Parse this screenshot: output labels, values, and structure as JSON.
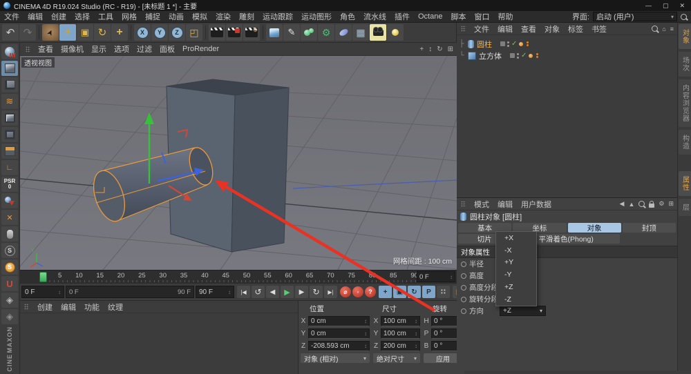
{
  "window": {
    "title": "CINEMA 4D R19.024 Studio (RC - R19) - [未标题 1 *] - 主要",
    "minimize": "—",
    "maximize": "▢",
    "close": "✕"
  },
  "menubar": {
    "items": [
      "文件",
      "编辑",
      "创建",
      "选择",
      "工具",
      "网格",
      "捕捉",
      "动画",
      "模拟",
      "渲染",
      "雕刻",
      "运动跟踪",
      "运动图形",
      "角色",
      "流水线",
      "插件",
      "Octane",
      "脚本",
      "窗口",
      "帮助"
    ],
    "interface_label": "界面:",
    "interface_value": "启动 (用户)"
  },
  "toolbar": {
    "undo": "↶",
    "redo": "↷",
    "select": "➤",
    "move": "+",
    "scale": "▣",
    "rotate": "↻",
    "last_tool": "+",
    "x": "X",
    "y": "Y",
    "z": "Z",
    "coord_system": "◰",
    "pen": "✎",
    "gear": "⚙",
    "floor": "▦"
  },
  "left_dock": {
    "psr_label": "PSR",
    "psr_value": "0",
    "axis": "∟",
    "workplane": "≋",
    "snap_x": "✕",
    "snap_s": "S",
    "snap_s_on": "S",
    "magnet": "U",
    "plane_a": "◈",
    "plane_b": "◈",
    "brand_line1": "MAXON",
    "brand_line2": "CINE"
  },
  "viewport": {
    "menu": [
      "查看",
      "摄像机",
      "显示",
      "选项",
      "过滤",
      "面板",
      "ProRender"
    ],
    "icons": {
      "pan": "+",
      "zoom": "↕",
      "rotate": "↻",
      "toggle": "⊞"
    },
    "view_label": "透视视图",
    "grid_info": "网格间距 : 100 cm",
    "axis_label": "Y"
  },
  "timeline": {
    "ticks": [
      "0",
      "5",
      "10",
      "15",
      "20",
      "25",
      "30",
      "35",
      "40",
      "45",
      "50",
      "55",
      "60",
      "65",
      "70",
      "75",
      "80",
      "85",
      "90"
    ],
    "frame_field": "0 F",
    "current": "0 F",
    "range_start": "0 F",
    "range_end": "90 F",
    "end": "90 F"
  },
  "transport": {
    "to_start": "|◀",
    "play_reverse": "↺",
    "prev_frame": "◀",
    "play": "▶",
    "next_frame": "▶",
    "loop": "↻",
    "to_end": "▶|",
    "record": "⌀",
    "autokey": "◦",
    "keyselect": "?",
    "key_position": "+",
    "key_scale": "▣",
    "key_rotation": "↻",
    "key_parameter": "P",
    "key_pla": "∷",
    "sim_palette": "▤"
  },
  "materials": {
    "menu": [
      "创建",
      "编辑",
      "功能",
      "纹理"
    ]
  },
  "coordinates": {
    "position_header": "位置",
    "size_header": "尺寸",
    "rotation_header": "旋转",
    "labels": {
      "px": "X",
      "py": "Y",
      "pz": "Z",
      "sx": "X",
      "sy": "Y",
      "sz": "Z",
      "rh": "H",
      "rp": "P",
      "rb": "B"
    },
    "position": {
      "x": "0 cm",
      "y": "0 cm",
      "z": "-208.593 cm"
    },
    "size": {
      "x": "100 cm",
      "y": "100 cm",
      "z": "200 cm"
    },
    "rotation": {
      "h": "0 °",
      "p": "0 °",
      "b": "0 °"
    },
    "mode_dropdown": "对象 (相对)",
    "size_dropdown": "绝对尺寸",
    "apply_button": "应用"
  },
  "object_manager": {
    "menu": [
      "文件",
      "编辑",
      "查看",
      "对象",
      "标签",
      "书签"
    ],
    "icons": {
      "home": "⌂",
      "filter": "≡"
    },
    "check": "✓",
    "objects": [
      {
        "name": "圆柱"
      },
      {
        "name": "立方体"
      }
    ]
  },
  "right_tabs": {
    "top": [
      "对象",
      "场次",
      "内容浏览器",
      "构造"
    ],
    "bottom": [
      "属性",
      "层"
    ]
  },
  "attributes": {
    "menu": [
      "模式",
      "编辑",
      "用户数据"
    ],
    "icons": {
      "back": "◀",
      "up": "▲",
      "gear": "⚙",
      "panel": "⊞"
    },
    "title": "圆柱对象 [圆柱]",
    "tabs": [
      "基本",
      "坐标",
      "对象",
      "封顶"
    ],
    "active_tab": "对象",
    "tabs2": [
      "切片",
      "平滑着色(Phong)"
    ],
    "section": "对象属性",
    "leader": ". . . . .",
    "rows": [
      "半径",
      "高度",
      "高度分段",
      "旋转分段",
      "方向"
    ],
    "direction_value": "+Z",
    "dropdown_options": [
      "+X",
      "-X",
      "+Y",
      "-Y",
      "+Z",
      "-Z"
    ]
  },
  "colors": {
    "selection_orange": "#ec9a3a",
    "tab_active_blue": "#a9c7e4",
    "annotation_red": "#e83223"
  }
}
